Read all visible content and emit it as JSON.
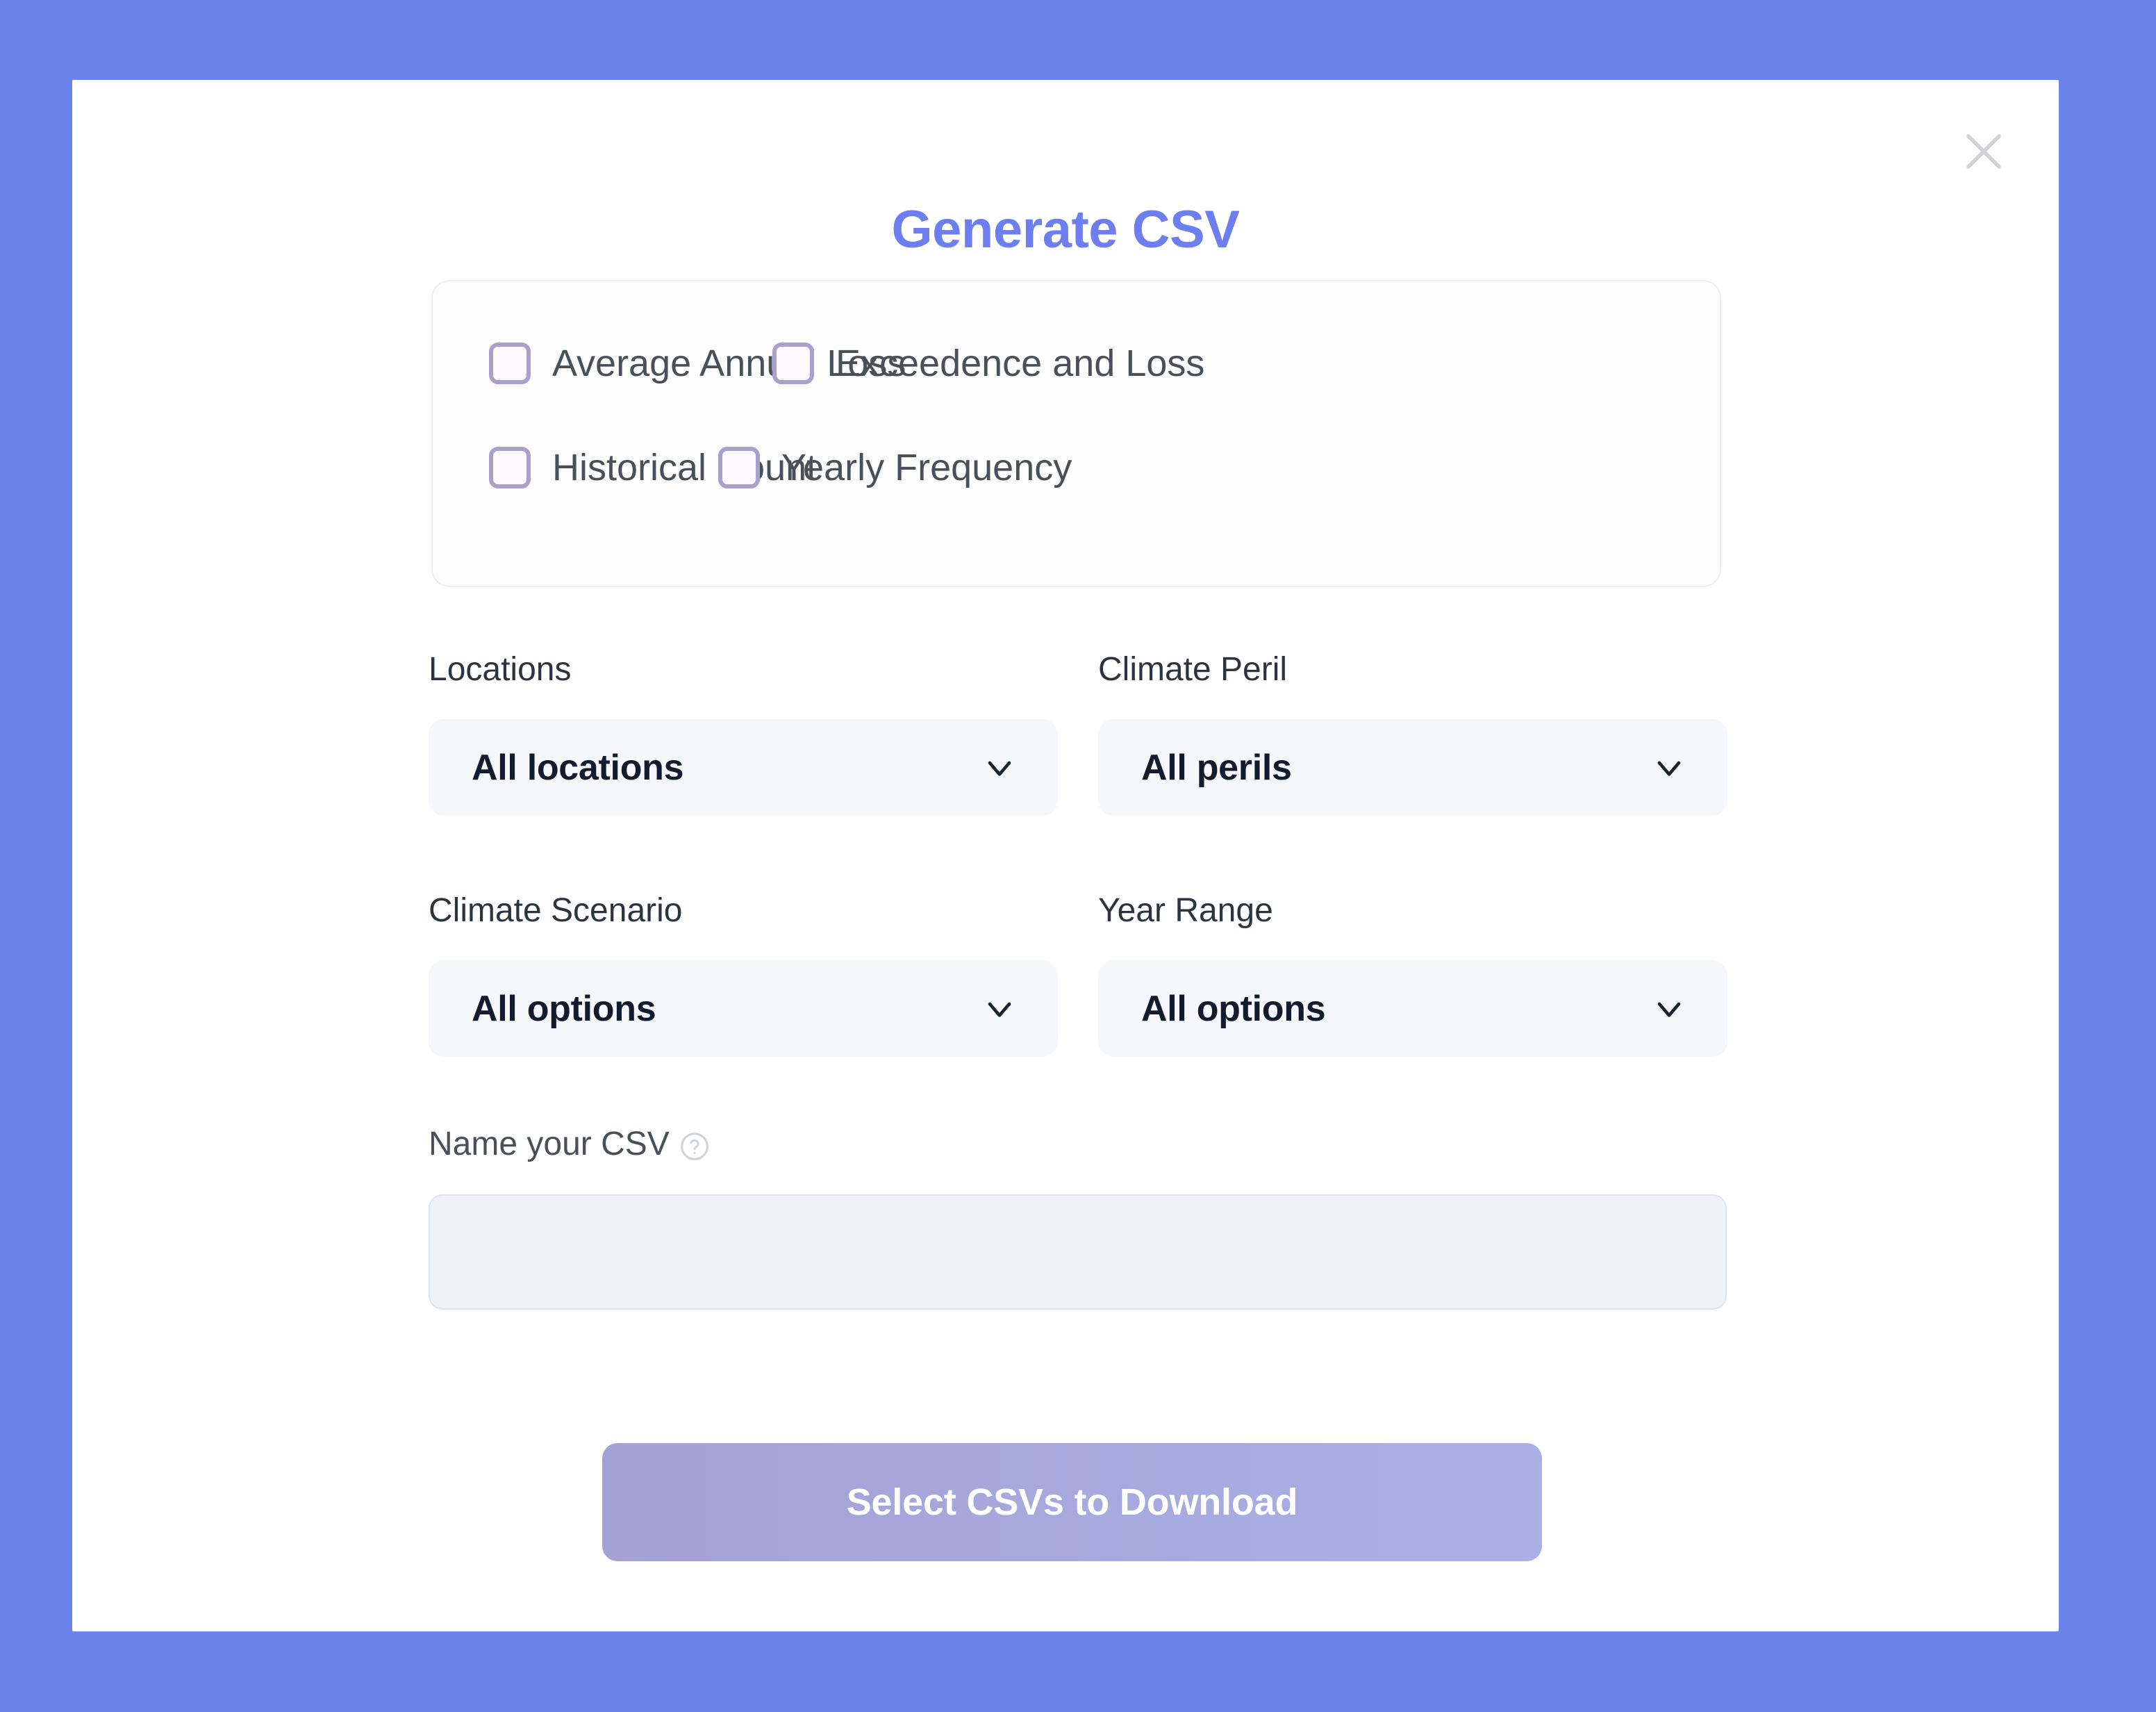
{
  "background_color": "#6a83eb",
  "modal": {
    "title": "Generate CSV",
    "title_color": "#6c7ef0",
    "close_icon_name": "close-icon"
  },
  "data_types": {
    "checkbox_border_color": "#a9a0cc",
    "options": [
      {
        "id": "average-annual-loss",
        "label": "Average Annual Loss",
        "checked": false
      },
      {
        "id": "exceedence-and-loss",
        "label": "Exceedence and Loss",
        "checked": false
      },
      {
        "id": "historical-count",
        "label": "Historical Count",
        "checked": false
      },
      {
        "id": "yearly-frequency",
        "label": "Yearly Frequency",
        "checked": false
      }
    ]
  },
  "filters": [
    {
      "id": "locations",
      "label": "Locations",
      "value": "All locations"
    },
    {
      "id": "climate-peril",
      "label": "Climate Peril",
      "value": "All perils"
    },
    {
      "id": "climate-scenario",
      "label": "Climate Scenario",
      "value": "All options"
    },
    {
      "id": "year-range",
      "label": "Year Range",
      "value": "All options"
    }
  ],
  "name_field": {
    "label": "Name your CSV",
    "help_icon_name": "help-circle-icon",
    "value": "",
    "placeholder": ""
  },
  "primary_action": {
    "label": "Select CSVs to Download",
    "gradient_start": "#a5a1d4",
    "gradient_end": "#aab0e6"
  }
}
